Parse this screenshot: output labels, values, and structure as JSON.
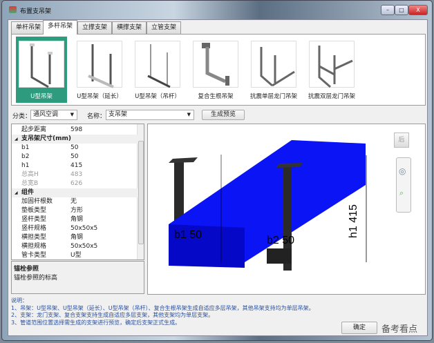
{
  "window": {
    "title": "布置支吊架",
    "controls": [
      "–",
      "□",
      "X"
    ]
  },
  "tabs": [
    {
      "label": "单杆吊架"
    },
    {
      "label": "多杆吊架",
      "active": true
    },
    {
      "label": "立撑支架"
    },
    {
      "label": "横撑支架"
    },
    {
      "label": "立管支架"
    }
  ],
  "gallery": [
    {
      "label": "U型吊架",
      "selected": true
    },
    {
      "label": "U型吊架（延长）"
    },
    {
      "label": "U型吊架（吊杆）"
    },
    {
      "label": "复合生根吊架"
    },
    {
      "label": "抗震单层龙门吊架"
    },
    {
      "label": "抗震双层龙门吊架"
    }
  ],
  "filter": {
    "category_label": "分类：",
    "category_value": "通风空调",
    "name_label": "名称：",
    "name_value": "支吊架",
    "preview_button": "生成预览"
  },
  "properties": [
    {
      "key": "起步距离",
      "value": "598"
    },
    {
      "key": "支吊架尺寸(mm)",
      "group": true
    },
    {
      "key": "b1",
      "value": "50"
    },
    {
      "key": "b2",
      "value": "50"
    },
    {
      "key": "h1",
      "value": "415"
    },
    {
      "key": "总高H",
      "value": "483",
      "disabled": true
    },
    {
      "key": "总宽B",
      "value": "626",
      "disabled": true
    },
    {
      "key": "组件",
      "group": true
    },
    {
      "key": "加固杆根数",
      "value": "无"
    },
    {
      "key": "垫板类型",
      "value": "方形"
    },
    {
      "key": "竖杆类型",
      "value": "角钢"
    },
    {
      "key": "竖杆规格",
      "value": "50x50x5"
    },
    {
      "key": "横担类型",
      "value": "角钢"
    },
    {
      "key": "横担规格",
      "value": "50x50x5"
    },
    {
      "key": "管卡类型",
      "value": "U型"
    }
  ],
  "description": {
    "title": "锚栓参照",
    "text": "锚栓参照的标高"
  },
  "viewport": {
    "dims": {
      "b1": "b1 50",
      "b2": "b2 50",
      "h1": "h1 415"
    },
    "viewcube_label": "后",
    "duct_color": "#0a14f5"
  },
  "notes": {
    "title": "说明：",
    "lines": [
      "1、吊架：U型吊架、U型吊架（延长）、U型吊架（吊杆）、复合生根吊架生成自适应多层吊架，其他吊架支持均为单层吊架。",
      "2、支架：龙门支架、复合支架支持生成自适应多层支架，其他支架均为单层支架。",
      "3、管道范围位置选择需生成的支架进行预览，确定后支架正式生成。"
    ]
  },
  "buttons": {
    "ok": "确定"
  },
  "watermark": "备考看点"
}
